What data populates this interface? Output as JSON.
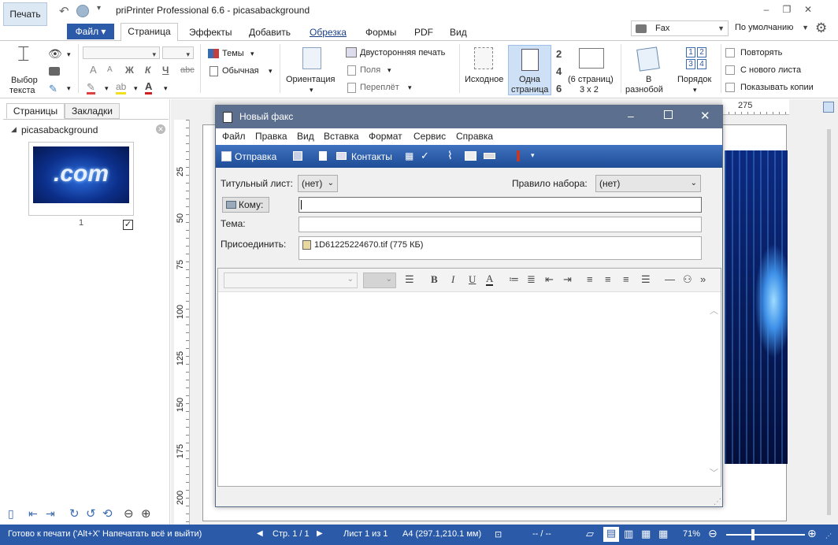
{
  "titlebar": {
    "print_label": "Печать",
    "app_title": "priPrinter Professional 6.6 - picasabackground"
  },
  "tabs": {
    "file": "Файл",
    "items": [
      "Страница",
      "Эффекты",
      "Добавить",
      "Обрезка",
      "Формы",
      "PDF",
      "Вид"
    ]
  },
  "printer": {
    "name": "Fax",
    "preset": "По умолчанию"
  },
  "ribbon": {
    "select_text": [
      "Выбор",
      "текста"
    ],
    "themes": "Темы",
    "normal": "Обычная",
    "orientation": "Ориентация",
    "duplex": "Двусторонняя печать",
    "margins": "Поля",
    "binding": "Переплёт",
    "original": "Исходное",
    "one_page": [
      "Одна",
      "страница"
    ],
    "pages_num_a": "2",
    "pages_num_b": "4",
    "pages_num_c": "6",
    "six_pages": [
      "(6 страниц)",
      "3 x 2"
    ],
    "scatter": [
      "В",
      "разнобой"
    ],
    "order": "Порядок",
    "order_nums": [
      "1",
      "2",
      "3",
      "4"
    ],
    "repeat": "Повторять",
    "new_sheet": "С нового листа",
    "show_copies": "Показывать копии",
    "font_sizes": [
      "A",
      "A"
    ],
    "bold": "Ж",
    "italic": "К",
    "underline": "Ч",
    "strike": "abc"
  },
  "leftpanel": {
    "tab_pages": "Страницы",
    "tab_bookmarks": "Закладки",
    "tree_item": "picasabackground",
    "thumb_number": "1",
    "thumb_text": ".com"
  },
  "ruler": {
    "top_mark": "275",
    "left_marks": [
      "25",
      "50",
      "75",
      "100",
      "125",
      "150",
      "175",
      "200"
    ]
  },
  "fax": {
    "title": "Новый факс",
    "menu": [
      "Файл",
      "Правка",
      "Вид",
      "Вставка",
      "Формат",
      "Сервис",
      "Справка"
    ],
    "toolbar": {
      "send": "Отправка",
      "contacts": "Контакты"
    },
    "cover_label": "Титульный лист:",
    "cover_value": "(нет)",
    "dial_label": "Правило набора:",
    "dial_value": "(нет)",
    "to_button": "Кому:",
    "subject_label": "Тема:",
    "attach_label": "Присоединить:",
    "attachment": "1D61225224670.tif (775 КБ)",
    "editor": {
      "bold": "B",
      "italic": "I",
      "underline": "U",
      "color": "A",
      "more": "»"
    }
  },
  "status": {
    "left_text": "Готово к печати ('Alt+X' Напечатать всё и выйти)",
    "page": "Стр. 1 / 1",
    "sheet": "Лист 1 из 1",
    "paper": "A4 (297.1,210.1 мм)",
    "coords": "-- / --",
    "zoom": "71%"
  },
  "colors": {
    "accent": "#2b5aa8",
    "dialog_title": "#5c6f8e",
    "toolbar": "#2f62b0"
  }
}
